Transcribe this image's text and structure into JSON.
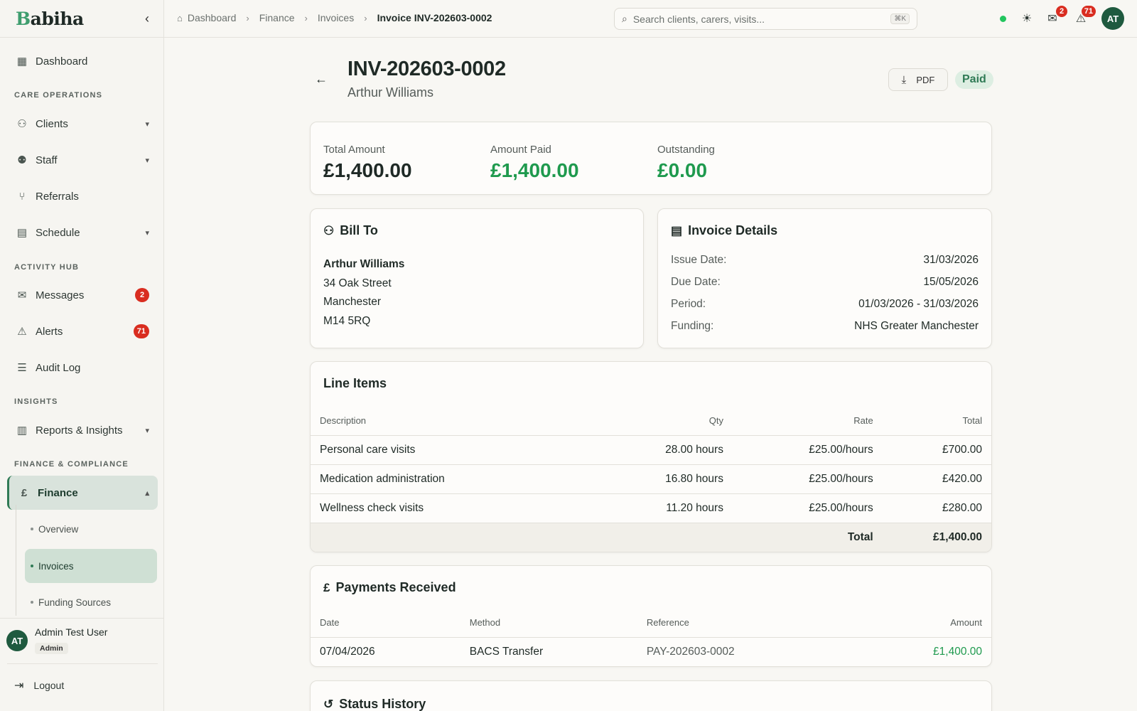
{
  "brand": {
    "logo_first": "B",
    "logo_rest": "abiha"
  },
  "sidebar": {
    "dashboard": "Dashboard",
    "sections": {
      "care": "CARE OPERATIONS",
      "activity": "ACTIVITY HUB",
      "insights": "INSIGHTS",
      "finance": "FINANCE & COMPLIANCE"
    },
    "clients": "Clients",
    "staff": "Staff",
    "referrals": "Referrals",
    "schedule": "Schedule",
    "messages": "Messages",
    "messages_count": "2",
    "alerts": "Alerts",
    "alerts_count": "71",
    "audit": "Audit Log",
    "reports": "Reports & Insights",
    "finance": "Finance",
    "finance_sub": [
      "Overview",
      "Invoices",
      "Funding Sources"
    ],
    "user_initials": "AT",
    "user_name": "Admin Test User",
    "user_role": "Admin",
    "logout": "Logout"
  },
  "topbar": {
    "breadcrumb": [
      "Dashboard",
      "Finance",
      "Invoices",
      "Invoice INV-202603-0002"
    ],
    "search_placeholder": "Search clients, carers, visits...",
    "shortcut": "⌘K",
    "messages_count": "2",
    "alerts_count": "71",
    "avatar": "AT"
  },
  "invoice": {
    "number": "INV-202603-0002",
    "client": "Arthur Williams",
    "pdf_label": "PDF",
    "status": "Paid",
    "summary": {
      "total_label": "Total Amount",
      "total": "£1,400.00",
      "paid_label": "Amount Paid",
      "paid": "£1,400.00",
      "outstanding_label": "Outstanding",
      "outstanding": "£0.00"
    },
    "bill_to": {
      "title": "Bill To",
      "lines": [
        "Arthur Williams",
        "34 Oak Street",
        "Manchester",
        "M14 5RQ"
      ]
    },
    "details": {
      "title": "Invoice Details",
      "rows": [
        {
          "k": "Issue Date:",
          "v": "31/03/2026"
        },
        {
          "k": "Due Date:",
          "v": "15/05/2026"
        },
        {
          "k": "Period:",
          "v": "01/03/2026 - 31/03/2026"
        },
        {
          "k": "Funding:",
          "v": "NHS Greater Manchester"
        }
      ]
    },
    "line_items": {
      "title": "Line Items",
      "headers": [
        "Description",
        "Qty",
        "Rate",
        "Total"
      ],
      "rows": [
        [
          "Personal care visits",
          "28.00 hours",
          "£25.00/hours",
          "£700.00"
        ],
        [
          "Medication administration",
          "16.80 hours",
          "£25.00/hours",
          "£420.00"
        ],
        [
          "Wellness check visits",
          "11.20 hours",
          "£25.00/hours",
          "£280.00"
        ]
      ],
      "total_label": "Total",
      "total": "£1,400.00"
    },
    "payments": {
      "title": "Payments Received",
      "headers": [
        "Date",
        "Method",
        "Reference",
        "Amount"
      ],
      "rows": [
        [
          "07/04/2026",
          "BACS Transfer",
          "PAY-202603-0002",
          "£1,400.00"
        ]
      ]
    },
    "status_history": {
      "title": "Status History"
    }
  },
  "colors": {
    "accent": "#2f7a55",
    "positive": "#1f9a4e",
    "badge": "#d92d20"
  }
}
